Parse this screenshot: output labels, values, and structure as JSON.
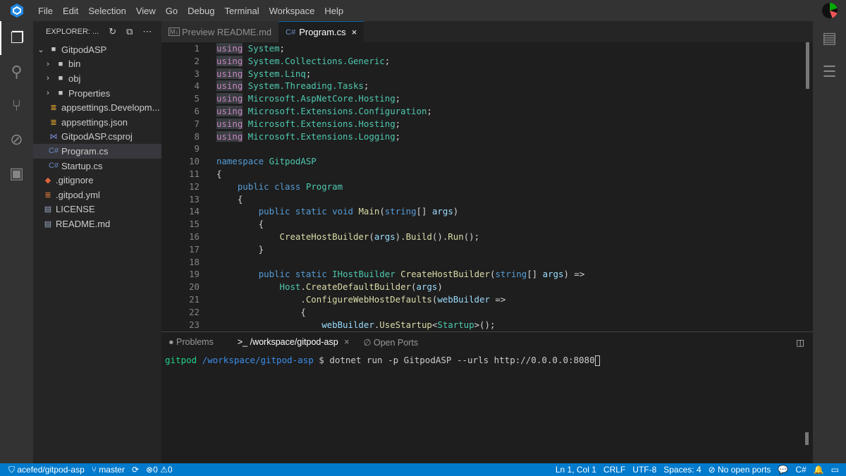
{
  "menubar": {
    "items": [
      "File",
      "Edit",
      "Selection",
      "View",
      "Go",
      "Debug",
      "Terminal",
      "Workspace",
      "Help"
    ]
  },
  "sidebar": {
    "title": "EXPLORER: ...",
    "items": [
      {
        "label": "GitpodASP",
        "icon": "folder-icon",
        "chev": "⌄",
        "indent": 0
      },
      {
        "label": "bin",
        "icon": "folder-icon",
        "chev": "›",
        "indent": 1
      },
      {
        "label": "obj",
        "icon": "folder-icon",
        "chev": "›",
        "indent": 1
      },
      {
        "label": "Properties",
        "icon": "folder-icon",
        "chev": "›",
        "indent": 1
      },
      {
        "label": "appsettings.Developm...",
        "icon": "json-icon",
        "chev": "",
        "indent": 1
      },
      {
        "label": "appsettings.json",
        "icon": "json-icon",
        "chev": "",
        "indent": 1
      },
      {
        "label": "GitpodASP.csproj",
        "icon": "csproj-icon",
        "chev": "",
        "indent": 1
      },
      {
        "label": "Program.cs",
        "icon": "csharp-icon",
        "chev": "",
        "indent": 1,
        "selected": true
      },
      {
        "label": "Startup.cs",
        "icon": "csharp-icon",
        "chev": "",
        "indent": 1
      },
      {
        "label": ".gitignore",
        "icon": "git-icon",
        "chev": "",
        "indent": 0
      },
      {
        "label": ".gitpod.yml",
        "icon": "yaml-icon",
        "chev": "",
        "indent": 0
      },
      {
        "label": "LICENSE",
        "icon": "text-file-icon",
        "chev": "",
        "indent": 0
      },
      {
        "label": "README.md",
        "icon": "text-file-icon",
        "chev": "",
        "indent": 0
      }
    ]
  },
  "tabs": [
    {
      "label": "Preview README.md",
      "icon": "markdown-preview-icon",
      "active": false
    },
    {
      "label": "Program.cs",
      "icon": "csharp-icon",
      "active": true,
      "close": "×"
    }
  ],
  "editor": {
    "lines": [
      [
        [
          "us",
          "using"
        ],
        [
          "tx",
          " "
        ],
        [
          "ty",
          "System"
        ],
        [
          "tx",
          ";"
        ]
      ],
      [
        [
          "us",
          "using"
        ],
        [
          "tx",
          " "
        ],
        [
          "ty",
          "System.Collections.Generic"
        ],
        [
          "tx",
          ";"
        ]
      ],
      [
        [
          "us",
          "using"
        ],
        [
          "tx",
          " "
        ],
        [
          "ty",
          "System.Linq"
        ],
        [
          "tx",
          ";"
        ]
      ],
      [
        [
          "us",
          "using"
        ],
        [
          "tx",
          " "
        ],
        [
          "ty",
          "System.Threading.Tasks"
        ],
        [
          "tx",
          ";"
        ]
      ],
      [
        [
          "us",
          "using"
        ],
        [
          "tx",
          " "
        ],
        [
          "ty",
          "Microsoft.AspNetCore.Hosting"
        ],
        [
          "tx",
          ";"
        ]
      ],
      [
        [
          "us",
          "using"
        ],
        [
          "tx",
          " "
        ],
        [
          "ty",
          "Microsoft.Extensions.Configuration"
        ],
        [
          "tx",
          ";"
        ]
      ],
      [
        [
          "us",
          "using"
        ],
        [
          "tx",
          " "
        ],
        [
          "ty",
          "Microsoft.Extensions.Hosting"
        ],
        [
          "tx",
          ";"
        ]
      ],
      [
        [
          "us",
          "using"
        ],
        [
          "tx",
          " "
        ],
        [
          "ty",
          "Microsoft.Extensions.Logging"
        ],
        [
          "tx",
          ";"
        ]
      ],
      [],
      [
        [
          "kw",
          "namespace"
        ],
        [
          "tx",
          " "
        ],
        [
          "ty",
          "GitpodASP"
        ]
      ],
      [
        [
          "tx",
          "{"
        ]
      ],
      [
        [
          "tx",
          "    "
        ],
        [
          "kw",
          "public"
        ],
        [
          "tx",
          " "
        ],
        [
          "kw",
          "class"
        ],
        [
          "tx",
          " "
        ],
        [
          "ty",
          "Program"
        ]
      ],
      [
        [
          "tx",
          "    {"
        ]
      ],
      [
        [
          "tx",
          "        "
        ],
        [
          "kw",
          "public"
        ],
        [
          "tx",
          " "
        ],
        [
          "kw",
          "static"
        ],
        [
          "tx",
          " "
        ],
        [
          "kw",
          "void"
        ],
        [
          "tx",
          " "
        ],
        [
          "fn",
          "Main"
        ],
        [
          "tx",
          "("
        ],
        [
          "kw",
          "string"
        ],
        [
          "tx",
          "[] "
        ],
        [
          "pa",
          "args"
        ],
        [
          "tx",
          ")"
        ]
      ],
      [
        [
          "tx",
          "        {"
        ]
      ],
      [
        [
          "tx",
          "            "
        ],
        [
          "fn",
          "CreateHostBuilder"
        ],
        [
          "tx",
          "("
        ],
        [
          "pa",
          "args"
        ],
        [
          "tx",
          ")."
        ],
        [
          "fn",
          "Build"
        ],
        [
          "tx",
          "()."
        ],
        [
          "fn",
          "Run"
        ],
        [
          "tx",
          "();"
        ]
      ],
      [
        [
          "tx",
          "        }"
        ]
      ],
      [],
      [
        [
          "tx",
          "        "
        ],
        [
          "kw",
          "public"
        ],
        [
          "tx",
          " "
        ],
        [
          "kw",
          "static"
        ],
        [
          "tx",
          " "
        ],
        [
          "ty",
          "IHostBuilder"
        ],
        [
          "tx",
          " "
        ],
        [
          "fn",
          "CreateHostBuilder"
        ],
        [
          "tx",
          "("
        ],
        [
          "kw",
          "string"
        ],
        [
          "tx",
          "[] "
        ],
        [
          "pa",
          "args"
        ],
        [
          "tx",
          ") =>"
        ]
      ],
      [
        [
          "tx",
          "            "
        ],
        [
          "ty",
          "Host"
        ],
        [
          "tx",
          "."
        ],
        [
          "fn",
          "CreateDefaultBuilder"
        ],
        [
          "tx",
          "("
        ],
        [
          "pa",
          "args"
        ],
        [
          "tx",
          ")"
        ]
      ],
      [
        [
          "tx",
          "                ."
        ],
        [
          "fn",
          "ConfigureWebHostDefaults"
        ],
        [
          "tx",
          "("
        ],
        [
          "pa",
          "webBuilder"
        ],
        [
          "tx",
          " =>"
        ]
      ],
      [
        [
          "tx",
          "                {"
        ]
      ],
      [
        [
          "tx",
          "                    "
        ],
        [
          "pa",
          "webBuilder"
        ],
        [
          "tx",
          "."
        ],
        [
          "fn",
          "UseStartup"
        ],
        [
          "tx",
          "<"
        ],
        [
          "ty",
          "Startup"
        ],
        [
          "tx",
          ">();"
        ]
      ]
    ]
  },
  "panel": {
    "tabs": [
      {
        "label": "Problems",
        "icon": "info-icon"
      },
      {
        "label": "/workspace/gitpod-asp",
        "icon": "terminal-icon",
        "active": true,
        "close": "×"
      },
      {
        "label": "Open Ports",
        "icon": "ports-icon"
      }
    ],
    "terminal": {
      "user": "gitpod",
      "path": "/workspace/gitpod-asp",
      "prompt": "$",
      "command": "dotnet run -p GitpodASP --urls http://0.0.0.0:8080"
    }
  },
  "status": {
    "repo": "acefed/gitpod-asp",
    "branch": "master",
    "errors": "0",
    "warnings": "0",
    "position": "Ln 1, Col 1",
    "eol": "CRLF",
    "encoding": "UTF-8",
    "spaces": "Spaces: 4",
    "ports": "No open ports",
    "language": "C#"
  },
  "colors": {
    "statusbar": "#007acc",
    "keyword": "#569cd6",
    "type": "#4ec9b0",
    "function": "#dcdcaa",
    "variable": "#9cdcfe"
  }
}
